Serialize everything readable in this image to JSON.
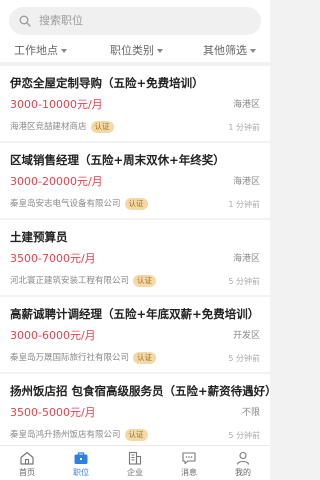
{
  "search": {
    "placeholder": "搜索职位",
    "icon": "search-icon"
  },
  "filters": [
    {
      "label": "工作地点"
    },
    {
      "label": "职位类别"
    },
    {
      "label": "其他筛选"
    }
  ],
  "jobs": [
    {
      "title": "伊恋全屋定制导购（五险+免费培训）",
      "salary": "3000-10000元/月",
      "district": "海港区",
      "company": "海港区竞喆建材商店",
      "badge": "认证",
      "time": "1 分钟前"
    },
    {
      "title": "区域销售经理（五险+周末双休+年终奖）",
      "salary": "3000-20000元/月",
      "district": "海港区",
      "company": "秦皇岛安志电气设备有限公司",
      "badge": "认证",
      "time": "1 分钟前"
    },
    {
      "title": "土建预算员",
      "salary": "3500-7000元/月",
      "district": "海港区",
      "company": "河北寰正建筑安装工程有限公司",
      "badge": "认证",
      "time": "5 分钟前"
    },
    {
      "title": "高薪诚聘计调经理（五险+年底双薪+免费培训）",
      "salary": "3000-6000元/月",
      "district": "开发区",
      "company": "秦皇岛万晟国际旅行社有限公司",
      "badge": "认证",
      "time": "5 分钟前"
    },
    {
      "title": "扬州饭店招 包食宿高级服务员（五险+薪资待遇好）",
      "salary": "3500-5000元/月",
      "district": "不限",
      "company": "秦皇岛鸿升扬州饭店有限公司",
      "badge": "认证",
      "time": "5 分钟前"
    }
  ],
  "tabs": [
    {
      "label": "首页",
      "icon": "home-icon"
    },
    {
      "label": "职位",
      "icon": "briefcase-icon",
      "active": true
    },
    {
      "label": "企业",
      "icon": "building-icon"
    },
    {
      "label": "消息",
      "icon": "message-icon"
    },
    {
      "label": "我的",
      "icon": "user-icon"
    }
  ],
  "colors": {
    "accent": "#2f7fe0",
    "salary": "#e5424b",
    "badge_bg": "#f3d9a8",
    "badge_text": "#a86c1f"
  }
}
